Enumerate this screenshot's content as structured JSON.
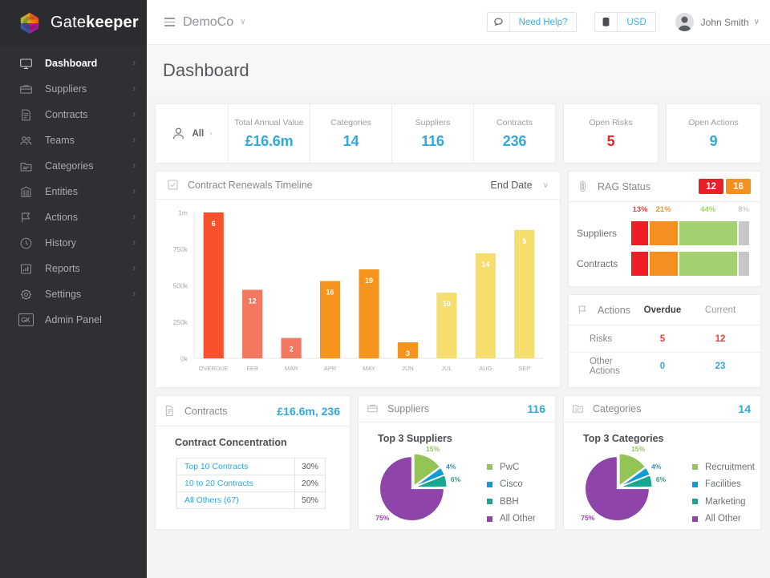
{
  "brand": {
    "name_thin": "Gate",
    "name_bold": "keeper",
    "logo_icon": "gatekeeper-hex-logo"
  },
  "sidebar": {
    "items": [
      {
        "label": "Dashboard",
        "icon": "monitor-icon",
        "chevron": "›",
        "active": true
      },
      {
        "label": "Suppliers",
        "icon": "briefcase-icon",
        "chevron": "›",
        "active": false
      },
      {
        "label": "Contracts",
        "icon": "document-icon",
        "chevron": "›",
        "active": false
      },
      {
        "label": "Teams",
        "icon": "people-icon",
        "chevron": "›",
        "active": false
      },
      {
        "label": "Categories",
        "icon": "folder-icon",
        "chevron": "›",
        "active": false
      },
      {
        "label": "Entities",
        "icon": "bank-icon",
        "chevron": "›",
        "active": false
      },
      {
        "label": "Actions",
        "icon": "flag-icon",
        "chevron": "›",
        "active": false
      },
      {
        "label": "History",
        "icon": "clock-icon",
        "chevron": "›",
        "active": false
      },
      {
        "label": "Reports",
        "icon": "bar-chart-icon",
        "chevron": "›",
        "active": false
      },
      {
        "label": "Settings",
        "icon": "gear-icon",
        "chevron": "›",
        "active": false
      },
      {
        "label": "Admin Panel",
        "icon": "gk-badge-icon",
        "chevron": "",
        "active": false
      }
    ],
    "admin_badge_text": "GK"
  },
  "topbar": {
    "menu_icon": "hamburger-icon",
    "org_name": "DemoCo",
    "org_caret": "∨",
    "help_label": "Need Help?",
    "help_icon": "speech-bubble-icon",
    "currency_label": "USD",
    "currency_icon": "database-icon",
    "user_name": "John Smith",
    "user_caret": "∨",
    "avatar_icon": "user-avatar"
  },
  "page": {
    "title": "Dashboard"
  },
  "kpis": {
    "filter": {
      "label": "All",
      "icon": "person-icon",
      "chevron": "›"
    },
    "items": [
      {
        "label": "Total Annual Value",
        "value": "£16.6m",
        "color": "#2fa8e0"
      },
      {
        "label": "Categories",
        "value": "14",
        "color": "#2fa8e0"
      },
      {
        "label": "Suppliers",
        "value": "116",
        "color": "#2fa8e0"
      },
      {
        "label": "Contracts",
        "value": "236",
        "color": "#2fa8e0"
      }
    ],
    "open_risks": {
      "label": "Open Risks",
      "value": "5",
      "color": "#e8202a"
    },
    "open_actions": {
      "label": "Open Actions",
      "value": "9",
      "color": "#2fa8e0"
    }
  },
  "renewals": {
    "icon": "checklist-icon",
    "title": "Contract Renewals Timeline",
    "select_value": "End Date",
    "select_caret": "∨"
  },
  "rag": {
    "icon": "traffic-light-icon",
    "title": "RAG Status",
    "badges": [
      {
        "value": "12",
        "color": "#e8202a"
      },
      {
        "value": "16",
        "color": "#f49020"
      }
    ],
    "percent_labels": [
      {
        "text": "13%",
        "color": "#e8413a"
      },
      {
        "text": "21%",
        "color": "#f49020"
      },
      {
        "text": "44%",
        "color": "#a4d170"
      },
      {
        "text": "8%",
        "color": "#c8cacc"
      }
    ],
    "rows": [
      {
        "label": "Suppliers",
        "segments": [
          13,
          21,
          44,
          8
        ]
      },
      {
        "label": "Contracts",
        "segments": [
          13,
          21,
          44,
          8
        ]
      }
    ],
    "segment_colors": [
      "#ee1c26",
      "#f49020",
      "#a4d170",
      "#c5c7c9"
    ]
  },
  "actions": {
    "icon": "flag-icon",
    "title": "Actions",
    "col_overdue": "Overdue",
    "col_current": "Current",
    "rows": [
      {
        "name": "Risks",
        "overdue": "5",
        "current": "12",
        "tone": "red"
      },
      {
        "name": "Other Actions",
        "overdue": "0",
        "current": "23",
        "tone": "blue"
      }
    ]
  },
  "contracts_panel": {
    "icon": "document-icon",
    "title": "Contracts",
    "head_value": "£16.6m, 236",
    "subtitle": "Contract Concentration",
    "rows": [
      {
        "name": "Top 10 Contracts",
        "pct": "30%"
      },
      {
        "name": "10 to 20 Contracts",
        "pct": "20%"
      },
      {
        "name": "All Others (67)",
        "pct": "50%"
      }
    ]
  },
  "suppliers_panel": {
    "icon": "briefcase-icon",
    "title": "Suppliers",
    "head_value": "116",
    "subtitle": "Top 3 Suppliers"
  },
  "categories_panel": {
    "icon": "folder-icon",
    "title": "Categories",
    "head_value": "14",
    "subtitle": "Top 3 Categories"
  },
  "chart_data": [
    {
      "type": "bar",
      "title": "Contract Renewals Timeline",
      "xlabel": "",
      "ylabel": "",
      "ylim": [
        0,
        1000000
      ],
      "ytick_labels": [
        "0k",
        "250k",
        "500k",
        "750k",
        "1m"
      ],
      "ytick_values": [
        0,
        250000,
        500000,
        750000,
        1000000
      ],
      "grid": false,
      "categories": [
        "OVERDUE",
        "FEB",
        "MAR",
        "APR",
        "MAY",
        "JUN",
        "JUL",
        "AUG",
        "SEP"
      ],
      "values": [
        1000000,
        470000,
        140000,
        530000,
        610000,
        110000,
        450000,
        720000,
        880000
      ],
      "bar_labels": [
        "6",
        "12",
        "2",
        "16",
        "19",
        "3",
        "10",
        "14",
        "5"
      ],
      "bar_colors": [
        "#f9512c",
        "#f4785f",
        "#f4785f",
        "#f7941e",
        "#f7941e",
        "#f7941e",
        "#f5dd6e",
        "#f5dd6e",
        "#f5dd6e"
      ]
    },
    {
      "type": "pie",
      "title": "Top 3 Suppliers",
      "legend_position": "right",
      "labels": [
        "PwC",
        "Cisco",
        "BBH",
        "All Other"
      ],
      "values": [
        15,
        4,
        6,
        75
      ],
      "value_labels": [
        "15%",
        "4%",
        "6%",
        "75%"
      ],
      "colors": [
        "#94c356",
        "#0f9bd7",
        "#15a88f",
        "#8e44a8"
      ]
    },
    {
      "type": "pie",
      "title": "Top 3 Categories",
      "legend_position": "right",
      "labels": [
        "Recruitment",
        "Facilities",
        "Marketing",
        "All Other"
      ],
      "values": [
        15,
        4,
        6,
        75
      ],
      "value_labels": [
        "15%",
        "4%",
        "6%",
        "75%"
      ],
      "colors": [
        "#94c356",
        "#0f9bd7",
        "#15a88f",
        "#8e44a8"
      ]
    },
    {
      "type": "bar",
      "title": "RAG Status",
      "orientation": "horizontal",
      "stacked": true,
      "categories": [
        "Suppliers",
        "Contracts"
      ],
      "series": [
        {
          "name": "Red",
          "values": [
            13,
            13
          ]
        },
        {
          "name": "Amber",
          "values": [
            21,
            21
          ]
        },
        {
          "name": "Green",
          "values": [
            44,
            44
          ]
        },
        {
          "name": "Grey",
          "values": [
            8,
            8
          ]
        }
      ],
      "colors": [
        "#ee1c26",
        "#f49020",
        "#a4d170",
        "#c5c7c9"
      ]
    }
  ]
}
